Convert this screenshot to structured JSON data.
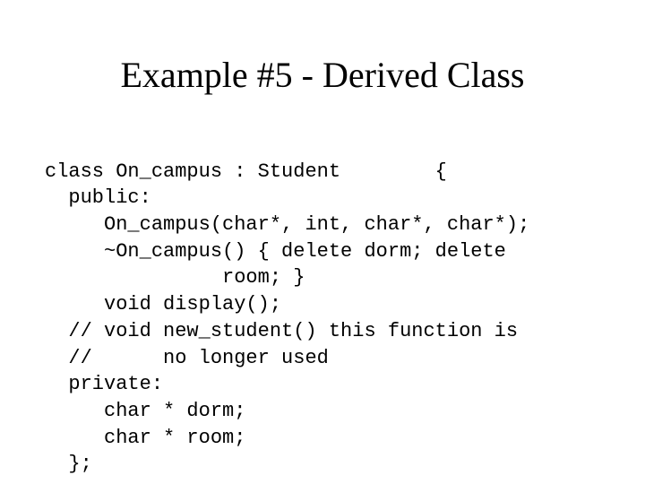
{
  "slide": {
    "title": "Example #5 - Derived Class",
    "code_lines": {
      "l0": "class On_campus : Student        {",
      "l1": "  public:",
      "l2": "     On_campus(char*, int, char*, char*);",
      "l3": "     ~On_campus() { delete dorm; delete",
      "l4": "               room; }",
      "l5": "     void display();",
      "l6": "  // void new_student() this function is",
      "l7": "  //      no longer used",
      "l8": "  private:",
      "l9": "     char * dorm;",
      "l10": "     char * room;",
      "l11": "  };"
    }
  }
}
